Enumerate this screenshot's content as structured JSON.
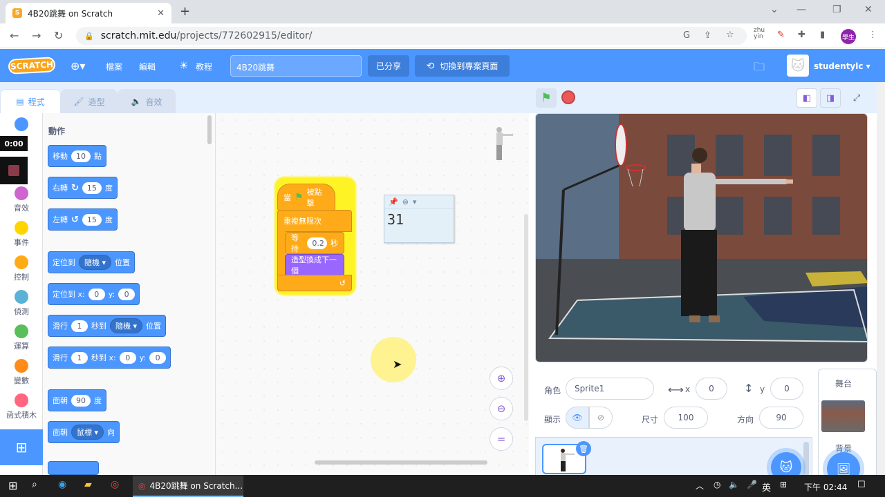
{
  "browser": {
    "tab_title": "4B20跳舞 on Scratch",
    "url_host": "scratch.mit.edu",
    "url_path": "/projects/772602915/editor/",
    "profile": "學生",
    "ext_zhuyin": "zhu\nyin"
  },
  "menubar": {
    "logo": "SCRATCH",
    "file": "檔案",
    "edit": "編輯",
    "tutorials": "教程",
    "project_title": "4B20跳舞",
    "shared": "已分享",
    "see_project_page": "切換到專案頁面",
    "username": "studentylc"
  },
  "editor_tabs": {
    "code": "程式",
    "costumes": "造型",
    "sounds": "音效"
  },
  "categories": [
    {
      "label": "動作",
      "color": "#4c97ff"
    },
    {
      "label": "音效",
      "color": "#cf63cf"
    },
    {
      "label": "事件",
      "color": "#ffd500"
    },
    {
      "label": "控制",
      "color": "#ffab19"
    },
    {
      "label": "偵測",
      "color": "#5cb1d6"
    },
    {
      "label": "運算",
      "color": "#59c059"
    },
    {
      "label": "變數",
      "color": "#ff8c1a"
    },
    {
      "label": "函式積木",
      "color": "#ff6680"
    }
  ],
  "timer": "0:00",
  "palette": {
    "heading": "動作",
    "move": {
      "a": "移動",
      "v": "10",
      "b": "點"
    },
    "turn_right": {
      "a": "右轉",
      "v": "15",
      "b": "度"
    },
    "turn_left": {
      "a": "左轉",
      "v": "15",
      "b": "度"
    },
    "goto": {
      "a": "定位到",
      "d": "隨機",
      "b": "位置"
    },
    "gotoxy": {
      "a": "定位到 x:",
      "x": "0",
      "y_label": "y:",
      "y": "0"
    },
    "glide": {
      "a": "滑行",
      "v": "1",
      "b": "秒到",
      "d": "隨機",
      "c": "位置"
    },
    "glidexy": {
      "a": "滑行",
      "v": "1",
      "b": "秒到 x:",
      "x": "0",
      "y_label": "y:",
      "y": "0"
    },
    "point_dir": {
      "a": "面朝",
      "v": "90",
      "b": "度"
    },
    "point_towards": {
      "a": "面朝",
      "d": "鼠標",
      "b": "向"
    }
  },
  "script": {
    "hat_a": "當",
    "hat_b": "被點擊",
    "forever": "重複無限次",
    "wait_a": "等待",
    "wait_v": "0.2",
    "wait_b": "秒",
    "next_costume": "造型換成下一個",
    "note_value": "31"
  },
  "sprite_info": {
    "sprite_label": "角色",
    "sprite_name": "Sprite1",
    "x_label": "x",
    "x": "0",
    "y_label": "y",
    "y": "0",
    "show_label": "顯示",
    "size_label": "尺寸",
    "size": "100",
    "direction_label": "方向",
    "direction": "90"
  },
  "stage_panel": {
    "title": "舞台",
    "backdrop_label": "背景"
  },
  "taskbar": {
    "app_label": "4B20跳舞 on Scratch...",
    "ime": "英",
    "clock": "下午 02:44"
  }
}
